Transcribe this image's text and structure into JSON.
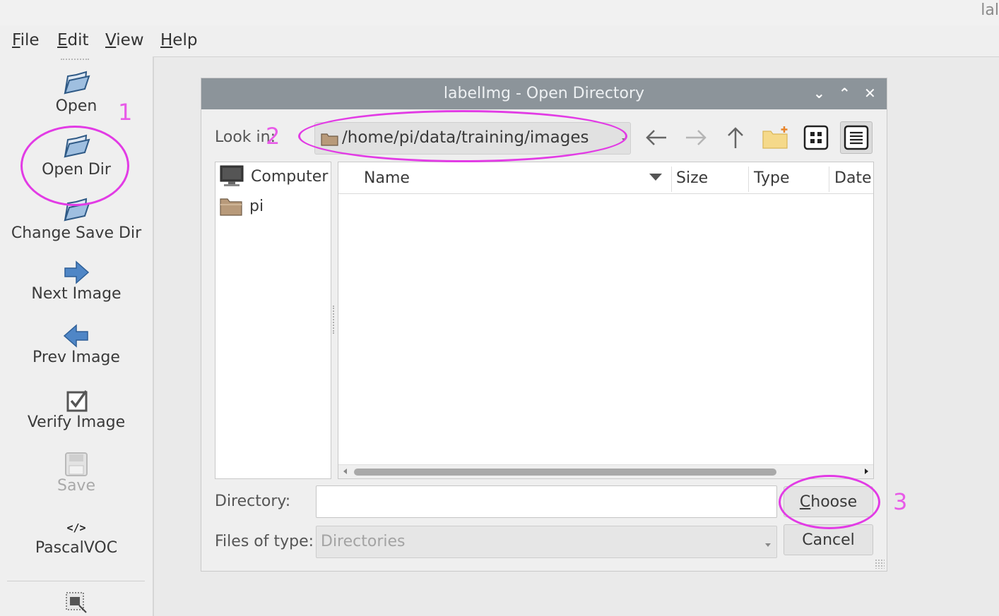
{
  "window": {
    "corner_title": "lal"
  },
  "menubar": {
    "items": [
      {
        "mnemonic": "F",
        "rest": "ile"
      },
      {
        "mnemonic": "E",
        "rest": "dit"
      },
      {
        "mnemonic": "V",
        "rest": "iew"
      },
      {
        "mnemonic": "H",
        "rest": "elp"
      }
    ]
  },
  "toolbar": {
    "open": "Open",
    "open_dir": "Open Dir",
    "change_save_dir": "Change Save Dir",
    "next_image": "Next Image",
    "prev_image": "Prev Image",
    "verify_image": "Verify Image",
    "save": "Save",
    "format_icon_text": "</>",
    "format": "PascalVOC"
  },
  "dialog": {
    "title": "labelImg - Open Directory",
    "look_in_label": "Look in:",
    "look_in_path": "/home/pi/data/training/images",
    "sidebar_items": [
      "Computer",
      "pi"
    ],
    "columns": [
      "Name",
      "Size",
      "Type",
      "Date"
    ],
    "directory_label": "Directory:",
    "directory_value": "",
    "files_of_type_label": "Files of type:",
    "files_of_type_value": "Directories",
    "choose_mnemonic": "C",
    "choose_rest": "hoose",
    "cancel": "Cancel",
    "window_buttons": {
      "minimize": "⌄",
      "maximize": "⌃",
      "close": "✕"
    }
  },
  "annotations": {
    "step1": "1",
    "step2": "2",
    "step3": "3",
    "color": "#e23be5"
  }
}
